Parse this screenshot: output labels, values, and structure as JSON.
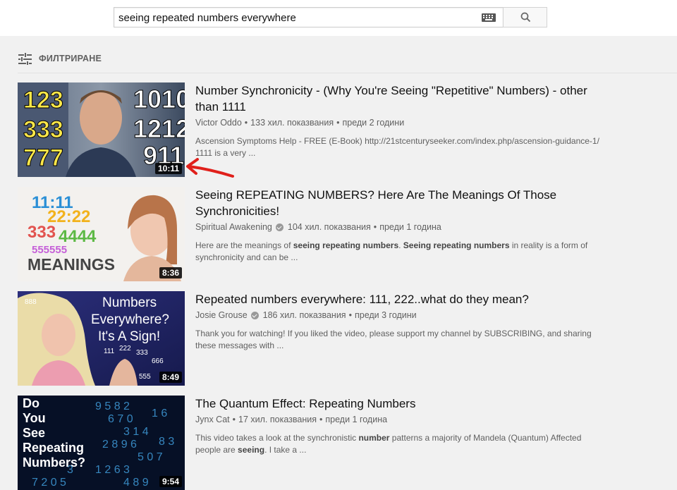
{
  "search": {
    "query": "seeing repeated numbers everywhere"
  },
  "filter": {
    "label": "ФИЛТРИРАНЕ"
  },
  "results": [
    {
      "title": "Number Synchronicity - (Why You're Seeing \"Repetitive\" Numbers) - other than 1111",
      "channel": "Victor Oddo",
      "verified": false,
      "views": "133 хил. показвания",
      "age": "преди 2 години",
      "description": [
        "Ascension Symptoms Help - FREE (E-Book) http://21stcenturyseeker.com/index.php/ascension-guidance-1/ 1111 is a very ..."
      ],
      "duration": "10:11",
      "thumb_text": [
        "123",
        "333",
        "777",
        "1010",
        "1212",
        "911"
      ]
    },
    {
      "title": "Seeing REPEATING NUMBERS? Here Are The Meanings Of Those Synchronicities!",
      "channel": "Spiritual Awakening",
      "verified": true,
      "views": "104 хил. показвания",
      "age": "преди 1 година",
      "description": [
        "Here are the meanings of ",
        "seeing repeating numbers",
        ". ",
        "Seeing repeating numbers",
        " in reality is a form of synchronicity and can be ..."
      ],
      "duration": "8:36",
      "thumb_text": [
        "11:11",
        "22:22",
        "333",
        "4444",
        "555555",
        "MEANINGS"
      ]
    },
    {
      "title": "Repeated numbers everywhere: 111, 222..what do they mean?",
      "channel": "Josie Grouse",
      "verified": true,
      "views": "186 хил. показвания",
      "age": "преди 3 години",
      "description": [
        "Thank you for watching! If you liked the video, please support my channel by SUBSCRIBING, and sharing these messages with ..."
      ],
      "duration": "8:49",
      "thumb_text": [
        "Numbers",
        "Everywhere?",
        "It's A Sign!",
        "888",
        "111",
        "222",
        "333",
        "666",
        "555"
      ]
    },
    {
      "title": "The Quantum Effect: Repeating Numbers",
      "channel": "Jynx Cat",
      "verified": false,
      "views": "17 хил. показвания",
      "age": "преди 1 година",
      "description": [
        "This video takes a look at the synchronistic ",
        "number",
        " patterns a majority of Mandela (Quantum) Affected people are ",
        "seeing",
        ". I take a ..."
      ],
      "duration": "9:54",
      "thumb_text": [
        "Do",
        "You",
        "See",
        "Repeating",
        "Numbers?"
      ]
    }
  ],
  "meta_separator": "•",
  "colors": {
    "page_bg": "#f1f1f1",
    "title": "#111111",
    "meta": "#606060",
    "annotation_arrow": "#e0201b"
  }
}
